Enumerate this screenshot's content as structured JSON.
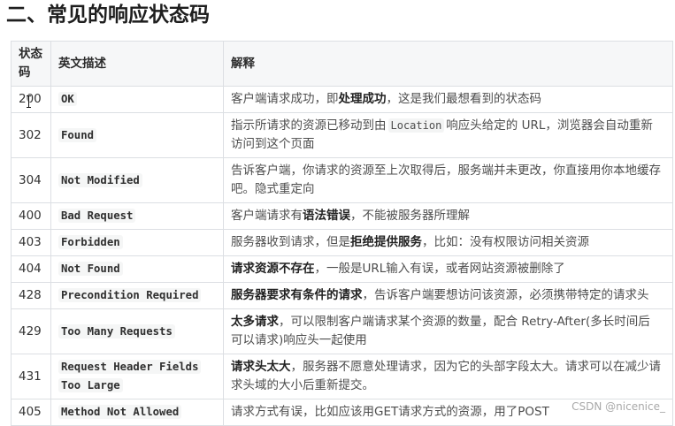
{
  "title": "二、常见的响应状态码",
  "table": {
    "headers": {
      "code": "状态码",
      "english": "英文描述",
      "explanation": "解释"
    },
    "rows": [
      {
        "code": "200",
        "english": "OK",
        "explanation": [
          {
            "plain": "客户端请求成功，即"
          },
          {
            "strong": "处理成功"
          },
          {
            "plain": "，这是我们最想看到的状态码"
          }
        ]
      },
      {
        "code": "302",
        "english": "Found",
        "explanation": [
          {
            "plain": "指示所请求的资源已移动到由"
          },
          {
            "code": "Location"
          },
          {
            "plain": "响应头给定的 URL，浏览器会自动重新访问到这个页面"
          }
        ]
      },
      {
        "code": "304",
        "english": "Not Modified",
        "explanation": [
          {
            "plain": "告诉客户端，你请求的资源至上次取得后，服务端并未更改，你直接用你本地缓存吧。隐式重定向"
          }
        ]
      },
      {
        "code": "400",
        "english": "Bad Request",
        "explanation": [
          {
            "plain": "客户端请求有"
          },
          {
            "strong": "语法错误"
          },
          {
            "plain": "，不能被服务器所理解"
          }
        ]
      },
      {
        "code": "403",
        "english": "Forbidden",
        "explanation": [
          {
            "plain": "服务器收到请求，但是"
          },
          {
            "strong": "拒绝提供服务"
          },
          {
            "plain": "，比如：没有权限访问相关资源"
          }
        ]
      },
      {
        "code": "404",
        "english": "Not Found",
        "explanation": [
          {
            "strong": "请求资源不存在"
          },
          {
            "plain": "，一般是URL输入有误，或者网站资源被删除了"
          }
        ]
      },
      {
        "code": "428",
        "english": "Precondition Required",
        "explanation": [
          {
            "strong": "服务器要求有条件的请求"
          },
          {
            "plain": "，告诉客户端要想访问该资源，必须携带特定的请求头"
          }
        ]
      },
      {
        "code": "429",
        "english": "Too Many Requests",
        "explanation": [
          {
            "strong": "太多请求"
          },
          {
            "plain": "，可以限制客户端请求某个资源的数量，配合 Retry-After(多长时间后可以请求)响应头一起使用"
          }
        ]
      },
      {
        "code": "431",
        "english": "Request Header Fields Too Large",
        "explanation": [
          {
            "strong": "请求头太大"
          },
          {
            "plain": "，服务器不愿意处理请求，因为它的头部字段太大。请求可以在减少请求头域的大小后重新提交。"
          }
        ]
      },
      {
        "code": "405",
        "english": "Method Not Allowed",
        "explanation": [
          {
            "plain": "请求方式有误，比如应该用GET请求方式的资源，用了POST"
          }
        ]
      }
    ]
  },
  "watermark": "CSDN @nicenice_",
  "icons": {
    "mouse_cursor": "text-cursor"
  }
}
